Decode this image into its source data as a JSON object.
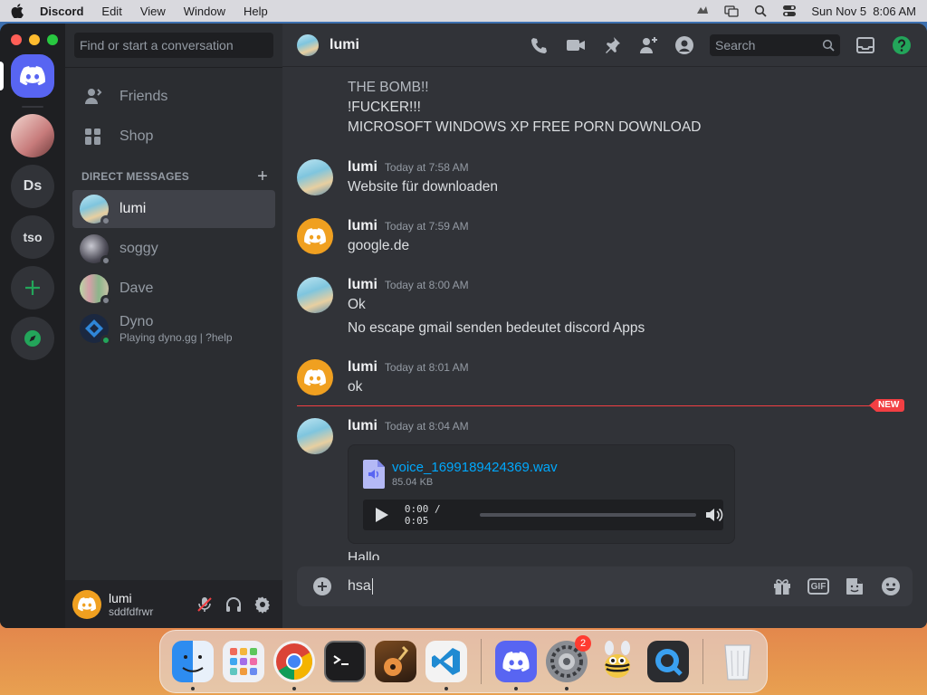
{
  "menubar": {
    "app_name": "Discord",
    "items": [
      "Edit",
      "View",
      "Window",
      "Help"
    ],
    "clock": "Sun Nov 5  8:06 AM"
  },
  "rail": {
    "servers": [
      {
        "label": "Ds"
      },
      {
        "label": "tso"
      }
    ],
    "add_label": "+"
  },
  "sidebar": {
    "search_placeholder": "Find or start a conversation",
    "nav": [
      {
        "label": "Friends",
        "icon": "friends-icon"
      },
      {
        "label": "Shop",
        "icon": "shop-icon"
      }
    ],
    "dm_header": "DIRECT MESSAGES",
    "dms": [
      {
        "name": "lumi",
        "status": "offline",
        "active": true
      },
      {
        "name": "soggy",
        "status": "offline"
      },
      {
        "name": "Dave",
        "status": "offline"
      },
      {
        "name": "Dyno",
        "status": "online",
        "activity": "Playing dyno.gg | ?help"
      }
    ],
    "user": {
      "name": "lumi",
      "tag": "sddfdfrwr"
    }
  },
  "chat": {
    "header_name": "lumi",
    "search_placeholder": "Search",
    "carryover_lines": [
      "THE BOMB!!",
      "!FUCKER!!!",
      "MICROSOFT WINDOWS XP FREE PORN DOWNLOAD"
    ],
    "messages": [
      {
        "author": "lumi",
        "avatar": "lumi",
        "time": "Today at 7:58 AM",
        "lines": [
          "Website für downloaden"
        ]
      },
      {
        "author": "lumi",
        "avatar": "discord",
        "time": "Today at 7:59 AM",
        "lines": [
          "google.de"
        ]
      },
      {
        "author": "lumi",
        "avatar": "lumi",
        "time": "Today at 8:00 AM",
        "lines": [
          "Ok",
          "No escape gmail senden bedeutet discord Apps"
        ]
      },
      {
        "author": "lumi",
        "avatar": "discord",
        "time": "Today at 8:01 AM",
        "lines": [
          "ok"
        ]
      },
      {
        "author": "lumi",
        "avatar": "lumi",
        "time": "Today at 8:04 AM",
        "lines": []
      }
    ],
    "new_label": "NEW",
    "attachment": {
      "filename": "voice_1699189424369.wav",
      "size": "85.04 KB",
      "time": "0:00 / 0:05",
      "progress": 0
    },
    "after_attachment": "Hallo",
    "composer_text": "hsa",
    "gif_label": "GIF"
  },
  "dock": {
    "apps": [
      "finder-icon",
      "launchpad-icon",
      "chrome-icon",
      "terminal-icon",
      "garageband-icon",
      "vscode-icon",
      "discord-icon",
      "system-settings-icon",
      "cyberduck-icon",
      "quicktime-icon",
      "trash-icon"
    ],
    "settings_badge": "2"
  },
  "colors": {
    "blurple": "#5865f2",
    "green": "#23a55a",
    "red": "#f23f43",
    "link": "#00a8fc",
    "discord_orange": "#f0a020"
  }
}
